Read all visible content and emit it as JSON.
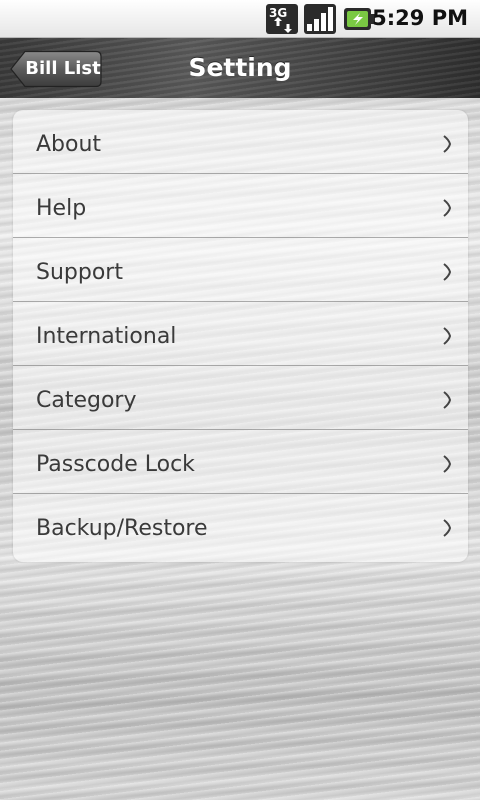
{
  "status_bar": {
    "network_type": "3G",
    "network_icon": "3g-data-icon",
    "signal_icon": "signal-strength-icon",
    "battery_icon": "battery-charging-icon",
    "time": "5:29 PM",
    "colors": {
      "battery_fill": "#7ac943"
    }
  },
  "header": {
    "back_label": "Bill List",
    "title": "Setting"
  },
  "settings": {
    "items": [
      {
        "label": "About",
        "icon": "chevron-right-icon"
      },
      {
        "label": "Help",
        "icon": "chevron-right-icon"
      },
      {
        "label": "Support",
        "icon": "chevron-right-icon"
      },
      {
        "label": "International",
        "icon": "chevron-right-icon"
      },
      {
        "label": "Category",
        "icon": "chevron-right-icon"
      },
      {
        "label": "Passcode Lock",
        "icon": "chevron-right-icon"
      },
      {
        "label": "Backup/Restore",
        "icon": "chevron-right-icon"
      }
    ]
  }
}
